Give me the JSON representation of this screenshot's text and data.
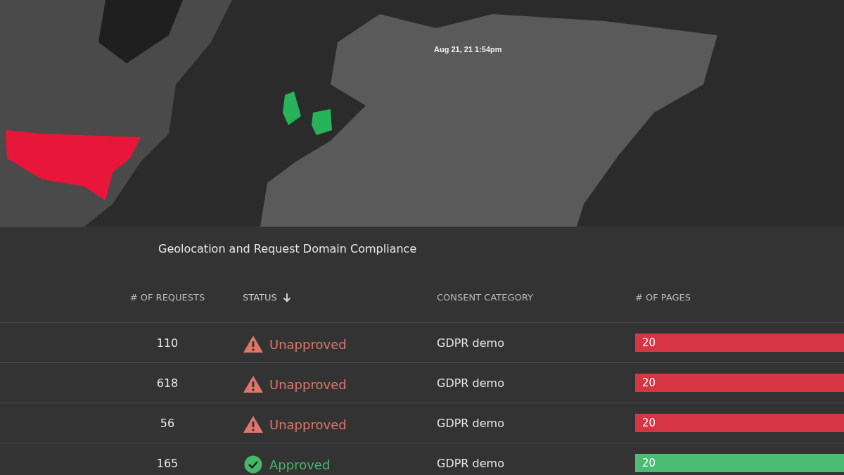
{
  "map": {
    "timestamp": "Aug 21, 21 1:54pm"
  },
  "title": "Geolocation and Request Domain Compliance",
  "table": {
    "columns": [
      {
        "label": "# OF REQUESTS",
        "sorted": false
      },
      {
        "label": "STATUS",
        "sorted": true
      },
      {
        "label": "CONSENT CATEGORY",
        "sorted": false
      },
      {
        "label": "# OF PAGES",
        "sorted": false
      }
    ],
    "rows": [
      {
        "requests": "110",
        "status": "Unapproved",
        "kind": "unapproved",
        "category": "GDPR demo",
        "pages": "20"
      },
      {
        "requests": "618",
        "status": "Unapproved",
        "kind": "unapproved",
        "category": "GDPR demo",
        "pages": "20"
      },
      {
        "requests": "56",
        "status": "Unapproved",
        "kind": "unapproved",
        "category": "GDPR demo",
        "pages": "20"
      },
      {
        "requests": "165",
        "status": "Approved",
        "kind": "approved",
        "category": "GDPR demo",
        "pages": "20"
      }
    ]
  }
}
